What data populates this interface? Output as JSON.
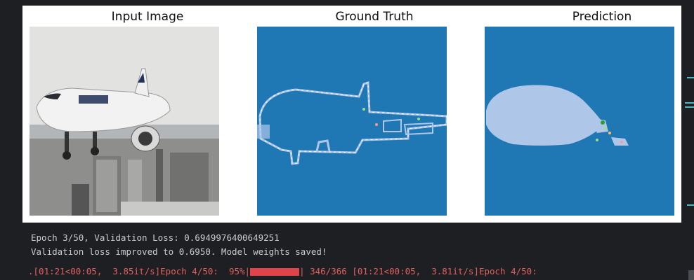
{
  "figure": {
    "panels": [
      {
        "title": "Input Image"
      },
      {
        "title": "Ground Truth"
      },
      {
        "title": "Prediction"
      }
    ],
    "colors": {
      "background_class": "#1f77b4",
      "airplane_class": "#aec7e8",
      "boundary": "#ffffff"
    }
  },
  "output": {
    "lines": [
      "Epoch 3/50, Validation Loss: 0.6949976400649251",
      "Validation loss improved to 0.6950. Model weights saved!"
    ],
    "progress_line": {
      "segments": [
        ".[01:21<00:05,  3.85it/s]Epoch 4/50:  95%|",
        "| 346/366 [01:21<00:05,  3.81it/s]Epoch 4/50:  "
      ]
    }
  }
}
